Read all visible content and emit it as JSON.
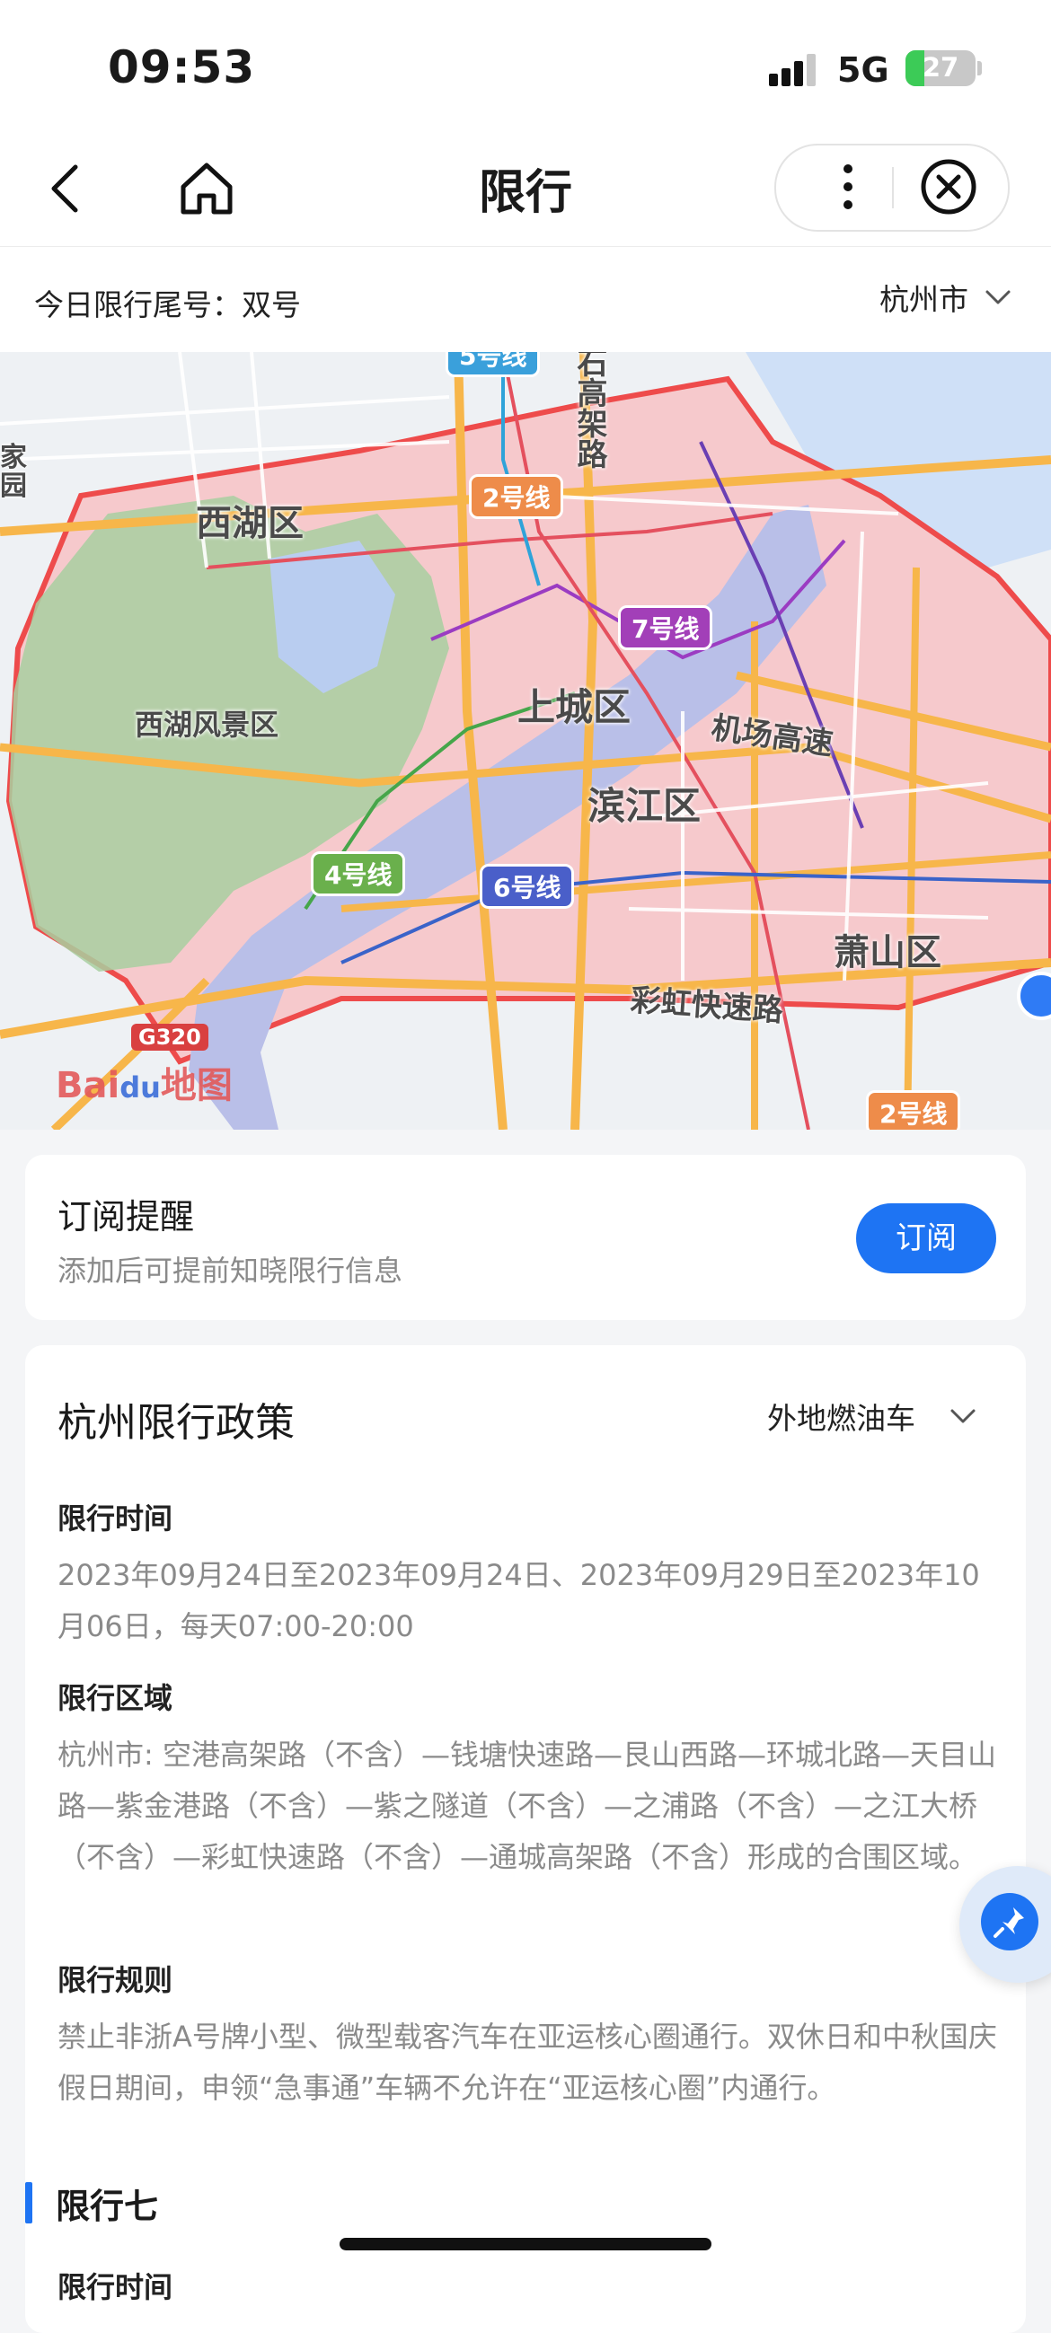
{
  "status_bar": {
    "time": "09:53",
    "network": "5G",
    "battery_level": "27",
    "battery_percent": 27
  },
  "nav": {
    "title": "限行"
  },
  "info": {
    "today_label": "今日限行尾号：双号",
    "city": "杭州市"
  },
  "map": {
    "district_labels": [
      "西湖区",
      "上城区",
      "滨江区",
      "萧山区",
      "西湖风景区"
    ],
    "road_labels": [
      "石高架路",
      "机场高速",
      "彩虹快速路"
    ],
    "metro_badges": [
      "2号线",
      "7号线",
      "4号线",
      "6号线",
      "2号线",
      "5号线"
    ],
    "highway_badge": "G320",
    "logo_text": "Bai",
    "logo_text2": "du",
    "logo_text3": "地图",
    "edge_labels": [
      "家",
      "园"
    ]
  },
  "subscribe": {
    "title": "订阅提醒",
    "description": "添加后可提前知晓限行信息",
    "button_label": "订阅"
  },
  "policy": {
    "title": "杭州限行政策",
    "vehicle_type": "外地燃油车",
    "sections": [
      {
        "heading": "限行时间",
        "body": "2023年09月24日至2023年09月24日、2023年09月29日至2023年10月06日，每天07:00-20:00"
      },
      {
        "heading": "限行区域",
        "body": "杭州市: 空港高架路（不含）—钱塘快速路—艮山西路—环城北路—天目山路—紫金港路（不含）—紫之隧道（不含）—之浦路（不含）—之江大桥（不含）—彩虹快速路（不含）—通城高架路（不含）形成的合围区域。"
      },
      {
        "heading": "限行规则",
        "body": "禁止非浙A号牌小型、微型载客汽车在亚运核心圈通行。双休日和中秋国庆假日期间，申领“急事通”车辆不允许在“亚运核心圈”内通行。"
      }
    ],
    "subsection_title": "限行七",
    "next_heading": "限行时间"
  },
  "colors": {
    "accent": "#1e74f3",
    "restricted_zone_fill": "#f6c9cc",
    "restricted_zone_border": "#ee4b4b"
  }
}
